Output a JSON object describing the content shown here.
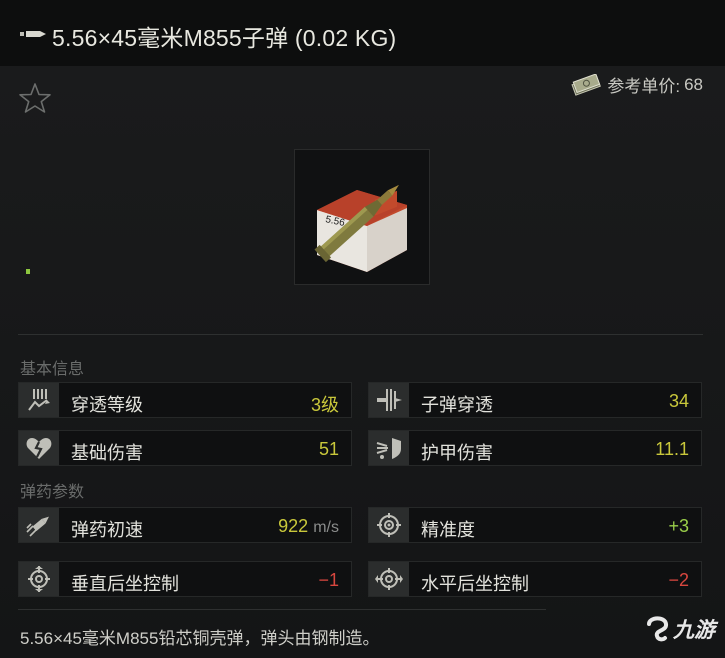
{
  "header": {
    "title": "5.56×45毫米M855子弹 (0.02 KG)",
    "icon": "bullet-icon"
  },
  "price": {
    "label": "参考单价:",
    "value": "68",
    "icon": "money-icon"
  },
  "favorite": {
    "icon": "star-icon"
  },
  "sections": {
    "basic": "基本信息",
    "ammo": "弹药参数"
  },
  "stats": {
    "penetration_level": {
      "label": "穿透等级",
      "value": "3级",
      "icon": "penetration-icon"
    },
    "bullet_penetration": {
      "label": "子弹穿透",
      "value": "34",
      "icon": "bullet-penetration-icon"
    },
    "base_damage": {
      "label": "基础伤害",
      "value": "51",
      "icon": "broken-heart-icon"
    },
    "armor_damage": {
      "label": "护甲伤害",
      "value": "11.1",
      "icon": "armor-damage-icon"
    },
    "muzzle_velocity": {
      "label": "弹药初速",
      "value": "922",
      "unit": "m/s",
      "icon": "velocity-icon"
    },
    "accuracy": {
      "label": "精准度",
      "value": "+3",
      "icon": "crosshair-icon"
    },
    "vertical_recoil": {
      "label": "垂直后坐控制",
      "value": "−1",
      "icon": "vertical-recoil-icon"
    },
    "horizontal_recoil": {
      "label": "水平后坐控制",
      "value": "−2",
      "icon": "horizontal-recoil-icon"
    }
  },
  "description": "5.56×45毫米M855铅芯铜壳弹，弹头由钢制造。",
  "watermark": {
    "text": "九游",
    "icon": "jiuyou-logo-icon"
  },
  "colors": {
    "yellow": "#c9c83b",
    "green": "#9acf4a",
    "red": "#d8473f"
  }
}
